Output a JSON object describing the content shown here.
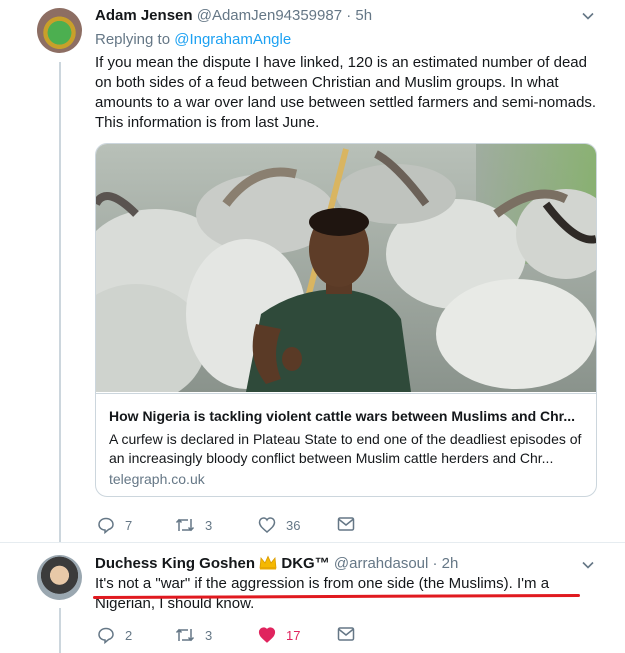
{
  "tweet1": {
    "name": "Adam Jensen",
    "handle": "@AdamJen94359987",
    "time": "· 5h",
    "replying_prefix": "Replying to ",
    "replying_to": "@IngrahamAngle",
    "text": "If you mean the dispute I have linked, 120 is an estimated number of dead on both sides of a feud between Christian and Muslim groups. In what amounts to a war over land use between settled farmers and semi-nomads. This information is from last June.",
    "card": {
      "title": "How Nigeria is tackling violent cattle wars between Muslims and Chr...",
      "description": "A curfew is declared in Plateau State to end one of the deadliest episodes of an increasingly bloody conflict between Muslim cattle herders and Chr...",
      "domain": "telegraph.co.uk"
    },
    "actions": {
      "replies": "7",
      "retweets": "3",
      "likes": "36"
    }
  },
  "tweet2": {
    "name": "Duchess King Goshen",
    "name_suffix": "DKG™",
    "handle": "@arrahdasoul",
    "time": "· 2h",
    "text": "It's not a \"war\" if the aggression is from one side (the Muslims). I'm a Nigerian, I should know.",
    "actions": {
      "replies": "2",
      "retweets": "3",
      "likes": "17"
    }
  },
  "colors": {
    "link": "#1da1f2",
    "muted": "#657786",
    "like_active": "#e0245e",
    "underline": "#e0191f"
  },
  "icons": [
    "chevron-down-icon",
    "reply-icon",
    "retweet-icon",
    "heart-icon",
    "mail-icon",
    "crown-icon"
  ]
}
